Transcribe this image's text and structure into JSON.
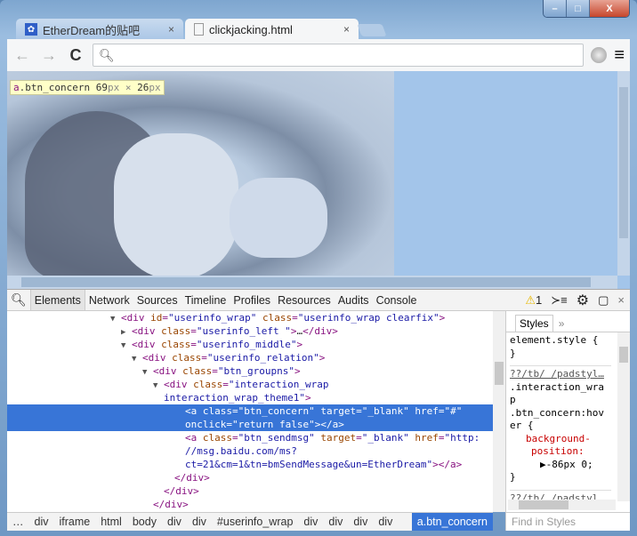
{
  "window": {
    "minimize": "–",
    "maximize": "□",
    "close": "X"
  },
  "tabs": [
    {
      "label": "EtherDream的贴吧",
      "close": "×"
    },
    {
      "label": "clickjacking.html",
      "close": "×"
    }
  ],
  "toolbar": {
    "back": "←",
    "forward": "→",
    "reload": "C",
    "search_icon": "search-icon",
    "address": "",
    "menu": "≡"
  },
  "inspect_tooltip": {
    "tag": "a",
    "cls": ".btn_concern",
    "w": "69",
    "h": "26",
    "unit": "px",
    "times": " × "
  },
  "devtools": {
    "tabs": [
      "Elements",
      "Network",
      "Sources",
      "Timeline",
      "Profiles",
      "Resources",
      "Audits",
      "Console"
    ],
    "warnings": "1",
    "dom": [
      {
        "indent": 10,
        "arrow": "▼",
        "tok": [
          [
            "tg",
            "<div "
          ],
          [
            "at",
            "id"
          ],
          [
            "tg",
            "="
          ],
          [
            "av",
            "\"userinfo_wrap\""
          ],
          [
            "tg",
            " "
          ],
          [
            "at",
            "class"
          ],
          [
            "tg",
            "="
          ],
          [
            "av",
            "\"userinfo_wrap clearfix\""
          ],
          [
            "tg",
            ">"
          ]
        ]
      },
      {
        "indent": 11,
        "arrow": "▶",
        "tok": [
          [
            "tg",
            "<div "
          ],
          [
            "at",
            "class"
          ],
          [
            "tg",
            "="
          ],
          [
            "av",
            "\"userinfo_left \""
          ],
          [
            "tg",
            ">"
          ],
          [
            "tx",
            "…"
          ],
          [
            "tg",
            "</div>"
          ]
        ]
      },
      {
        "indent": 11,
        "arrow": "▼",
        "tok": [
          [
            "tg",
            "<div "
          ],
          [
            "at",
            "class"
          ],
          [
            "tg",
            "="
          ],
          [
            "av",
            "\"userinfo_middle\""
          ],
          [
            "tg",
            ">"
          ]
        ]
      },
      {
        "indent": 12,
        "arrow": "▼",
        "tok": [
          [
            "tg",
            "<div "
          ],
          [
            "at",
            "class"
          ],
          [
            "tg",
            "="
          ],
          [
            "av",
            "\"userinfo_relation\""
          ],
          [
            "tg",
            ">"
          ]
        ]
      },
      {
        "indent": 13,
        "arrow": "▼",
        "tok": [
          [
            "tg",
            "<div "
          ],
          [
            "at",
            "class"
          ],
          [
            "tg",
            "="
          ],
          [
            "av",
            "\"btn_groupns\""
          ],
          [
            "tg",
            ">"
          ]
        ]
      },
      {
        "indent": 14,
        "arrow": "▼",
        "tok": [
          [
            "tg",
            "<div "
          ],
          [
            "at",
            "class"
          ],
          [
            "tg",
            "="
          ],
          [
            "av",
            "\"interaction_wrap"
          ]
        ]
      },
      {
        "indent": 14,
        "arrow": "",
        "tok": [
          [
            "av",
            "interaction_wrap_theme1\""
          ],
          [
            "tg",
            ">"
          ]
        ]
      },
      {
        "indent": 16,
        "arrow": "",
        "sel": true,
        "tok": [
          [
            "tg",
            "<a "
          ],
          [
            "at",
            "class"
          ],
          [
            "tg",
            "="
          ],
          [
            "av",
            "\"btn_concern\""
          ],
          [
            "tg",
            " "
          ],
          [
            "at",
            "target"
          ],
          [
            "tg",
            "="
          ],
          [
            "av",
            "\"_blank\""
          ],
          [
            "tg",
            " "
          ],
          [
            "at",
            "href"
          ],
          [
            "tg",
            "="
          ],
          [
            "av",
            "\"#\""
          ]
        ]
      },
      {
        "indent": 16,
        "arrow": "",
        "sel": true,
        "tok": [
          [
            "at",
            "onclick"
          ],
          [
            "tg",
            "="
          ],
          [
            "av",
            "\"return false\""
          ],
          [
            "tg",
            "></a>"
          ]
        ]
      },
      {
        "indent": 16,
        "arrow": "",
        "tok": [
          [
            "tg",
            "<a "
          ],
          [
            "at",
            "class"
          ],
          [
            "tg",
            "="
          ],
          [
            "av",
            "\"btn_sendmsg\""
          ],
          [
            "tg",
            " "
          ],
          [
            "at",
            "target"
          ],
          [
            "tg",
            "="
          ],
          [
            "av",
            "\"_blank\""
          ],
          [
            "tg",
            " "
          ],
          [
            "at",
            "href"
          ],
          [
            "tg",
            "="
          ],
          [
            "av",
            "\"http:"
          ]
        ]
      },
      {
        "indent": 16,
        "arrow": "",
        "tok": [
          [
            "av",
            "//msg.baidu.com/ms?"
          ]
        ]
      },
      {
        "indent": 16,
        "arrow": "",
        "tok": [
          [
            "av",
            "ct=21&cm=1&tn=bmSendMessage&un=EtherDream\""
          ],
          [
            "tg",
            "></a>"
          ]
        ]
      },
      {
        "indent": 15,
        "arrow": "",
        "tok": [
          [
            "tg",
            "</div>"
          ]
        ]
      },
      {
        "indent": 14,
        "arrow": "",
        "tok": [
          [
            "tg",
            "</div>"
          ]
        ]
      },
      {
        "indent": 13,
        "arrow": "",
        "tok": [
          [
            "tg",
            "</div>"
          ]
        ]
      }
    ],
    "styles": {
      "tab": "Styles",
      "more": "»",
      "element_style": "element.style {",
      "close_brace": "}",
      "source1": "??/tb/ /padstyl…",
      "sel1": ".interaction_wra",
      "sel2": "p",
      "sel3": ".btn_concern:hov",
      "sel4": "er {",
      "prop1": "background-",
      "prop2": "position:",
      "value": "▶-86px 0;",
      "source2": "??/tb/ /padstyl…"
    },
    "breadcrumbs": [
      "…",
      "div",
      "iframe",
      "html",
      "body",
      "div",
      "div",
      "#userinfo_wrap",
      "div",
      "div",
      "div",
      "div",
      "a.btn_concern"
    ],
    "find_placeholder": "Find in Styles"
  }
}
